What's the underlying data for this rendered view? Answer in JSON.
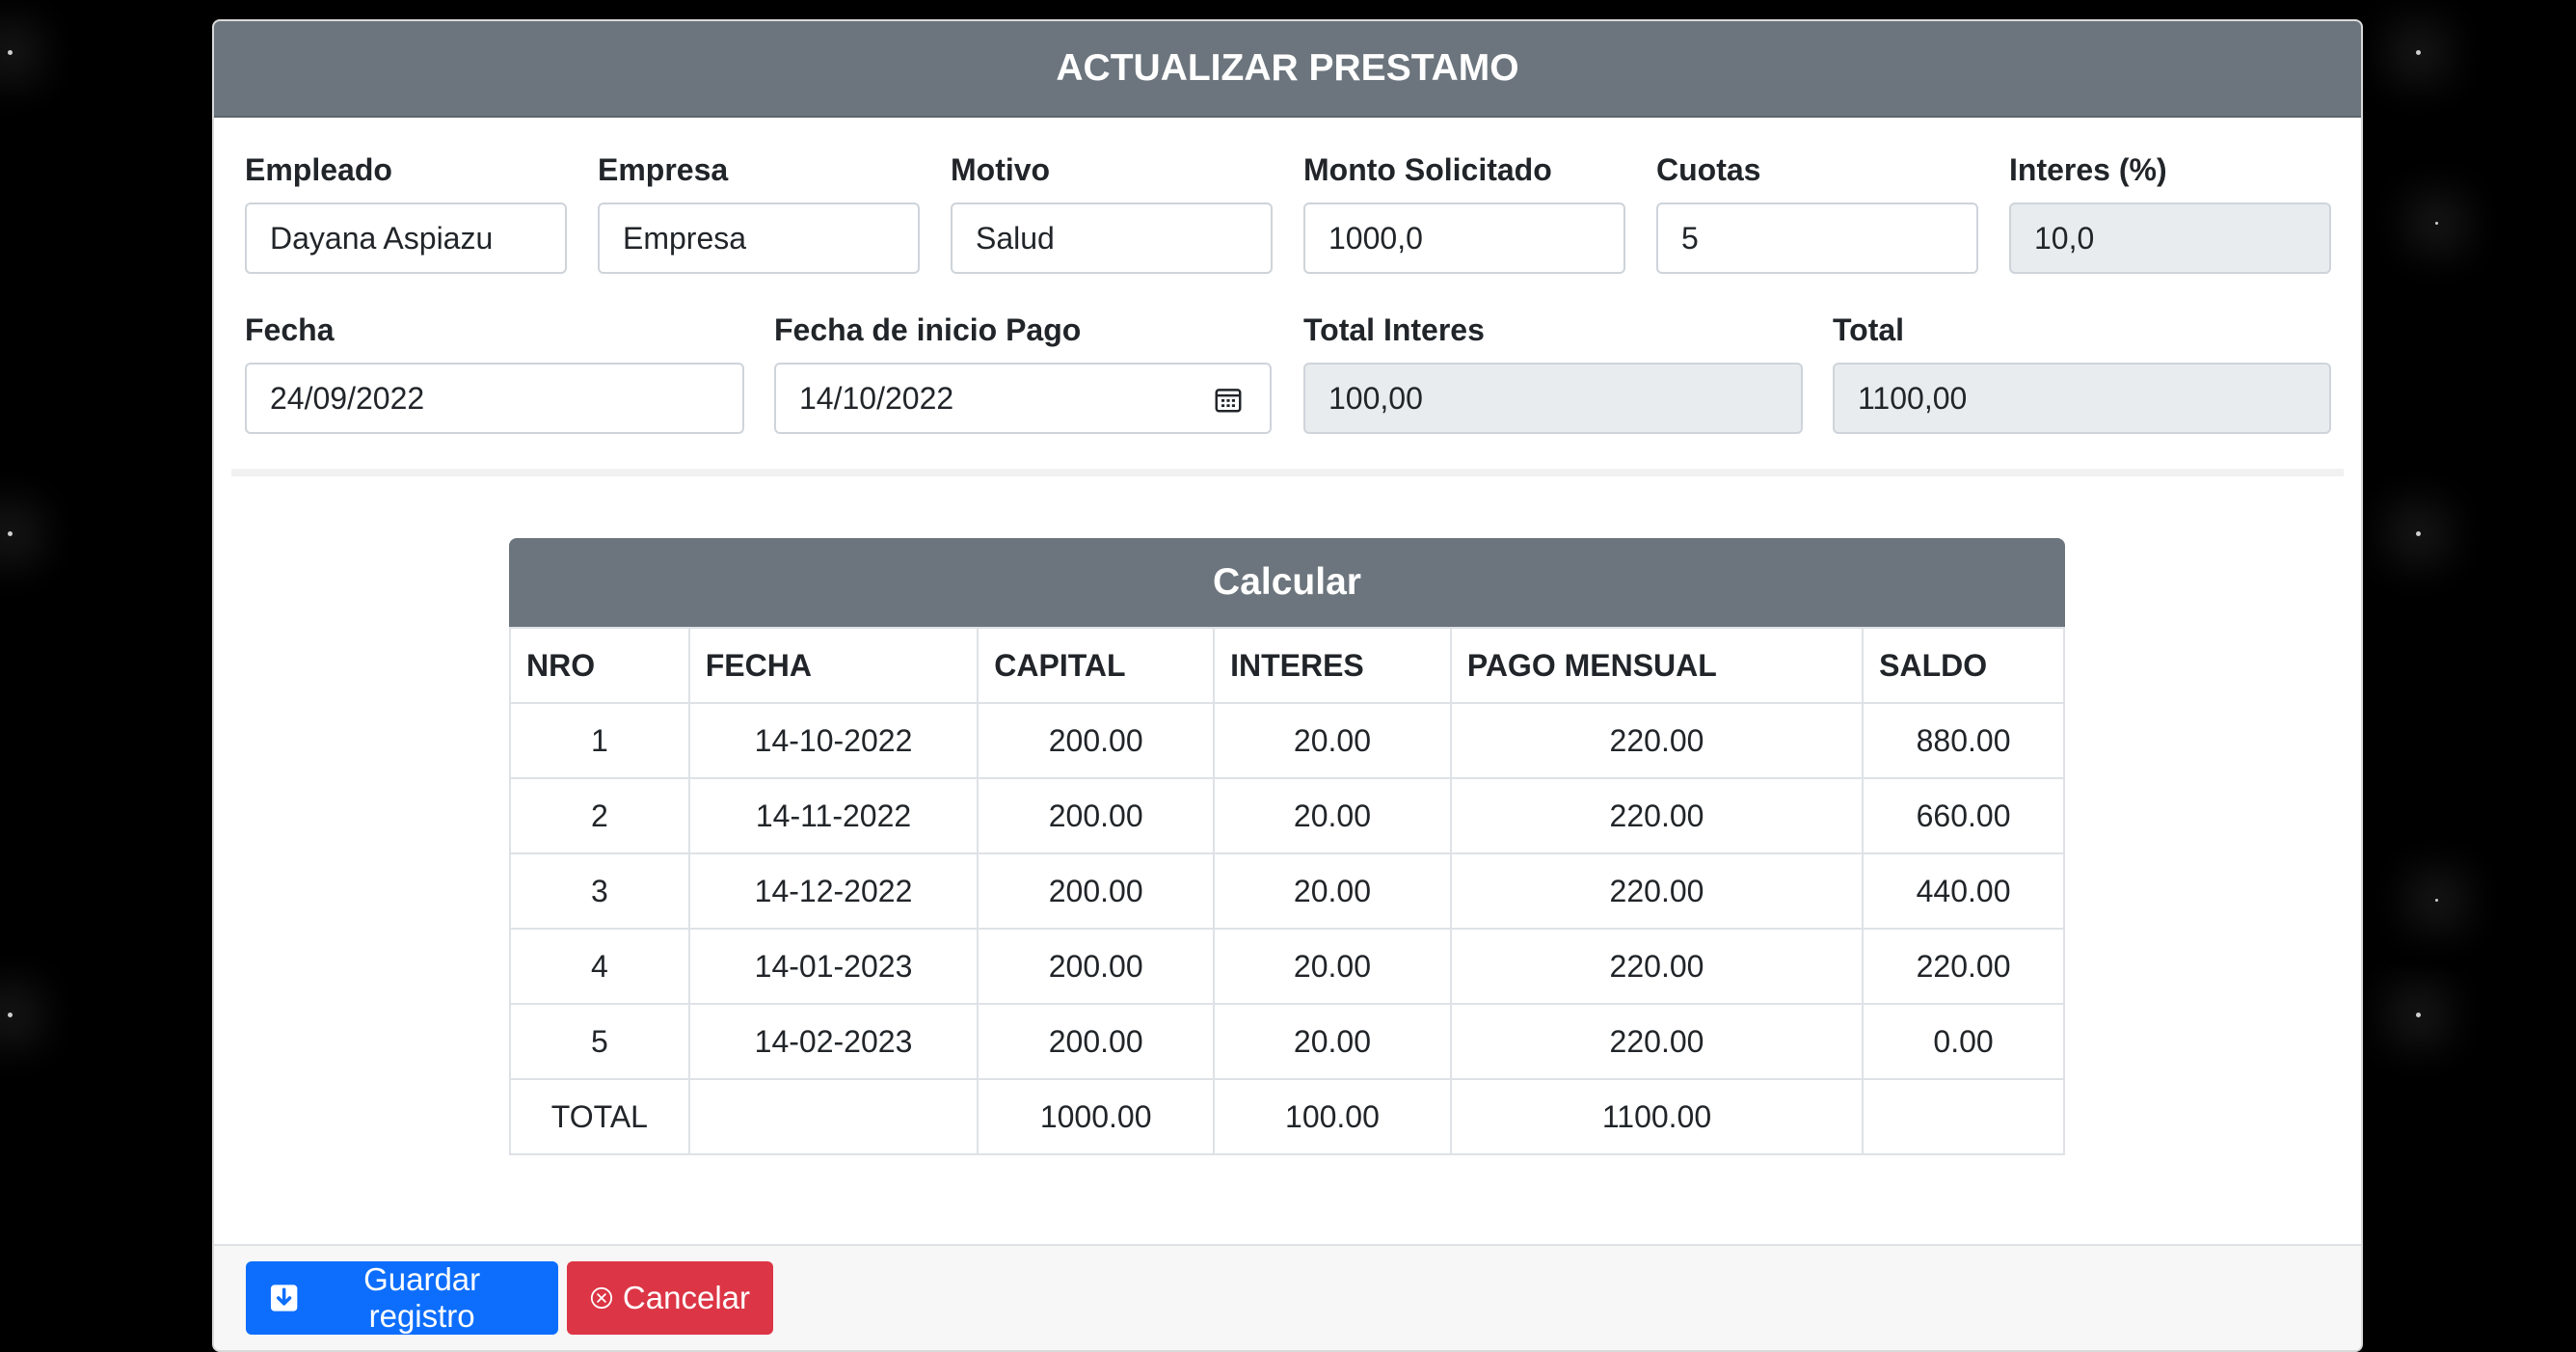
{
  "modal": {
    "title": "ACTUALIZAR PRESTAMO"
  },
  "form": {
    "empleado": {
      "label": "Empleado",
      "value": "Dayana Aspiazu"
    },
    "empresa": {
      "label": "Empresa",
      "value": "Empresa"
    },
    "motivo": {
      "label": "Motivo",
      "value": "Salud"
    },
    "monto": {
      "label": "Monto Solicitado",
      "value": "1000,0"
    },
    "cuotas": {
      "label": "Cuotas",
      "value": "5"
    },
    "interes": {
      "label": "Interes (%)",
      "value": "10,0"
    },
    "fecha": {
      "label": "Fecha",
      "value": "24/09/2022"
    },
    "fecha_inicio": {
      "label": "Fecha de inicio Pago",
      "value": "14/10/2022"
    },
    "total_interes": {
      "label": "Total Interes",
      "value": "100,00"
    },
    "total": {
      "label": "Total",
      "value": "1100,00"
    }
  },
  "calc": {
    "title": "Calcular",
    "headers": [
      "NRO",
      "FECHA",
      "CAPITAL",
      "INTERES",
      "PAGO MENSUAL",
      "SALDO"
    ],
    "rows": [
      [
        "1",
        "14-10-2022",
        "200.00",
        "20.00",
        "220.00",
        "880.00"
      ],
      [
        "2",
        "14-11-2022",
        "200.00",
        "20.00",
        "220.00",
        "660.00"
      ],
      [
        "3",
        "14-12-2022",
        "200.00",
        "20.00",
        "220.00",
        "440.00"
      ],
      [
        "4",
        "14-01-2023",
        "200.00",
        "20.00",
        "220.00",
        "220.00"
      ],
      [
        "5",
        "14-02-2023",
        "200.00",
        "20.00",
        "220.00",
        "0.00"
      ],
      [
        "TOTAL",
        "",
        "1000.00",
        "100.00",
        "1100.00",
        ""
      ]
    ]
  },
  "footer": {
    "save_label": "Guardar registro",
    "cancel_label": "Cancelar"
  },
  "colors": {
    "header_bg": "#6c757d",
    "primary": "#0d6efd",
    "danger": "#dc3545",
    "readonly_bg": "#e9ecef"
  },
  "icons": {
    "calendar": "calendar-icon",
    "save": "download-icon",
    "cancel": "circle-x-icon"
  }
}
